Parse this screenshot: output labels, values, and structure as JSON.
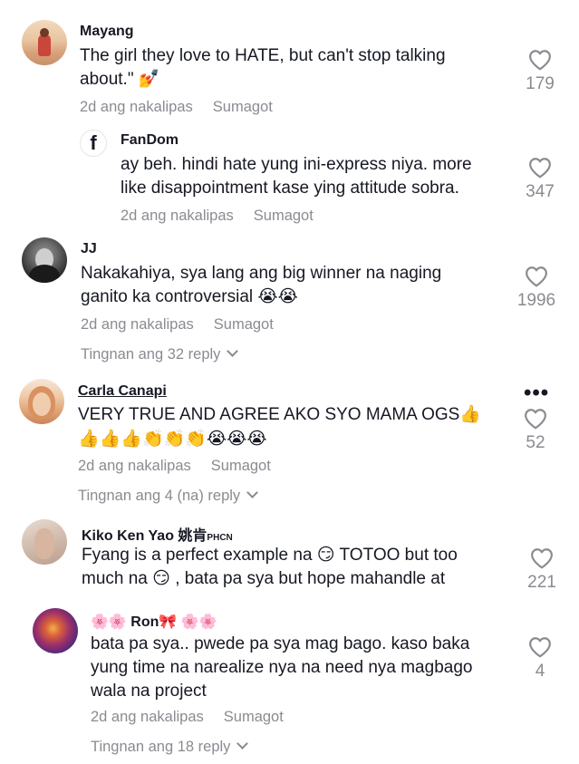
{
  "comments": [
    {
      "author": "Mayang",
      "lines": [
        "The girl they love to HATE, but can't stop talking",
        "about.\" 💅"
      ],
      "time": "2d ang nakalipas",
      "reply_label": "Sumagot",
      "likes": "179",
      "replies": [
        {
          "author": "FanDom",
          "avatar_letter": "f",
          "lines": [
            "ay beh. hindi hate yung ini-express niya. more",
            "like disappointment kase ying attitude sobra."
          ],
          "time": "2d ang nakalipas",
          "reply_label": "Sumagot",
          "likes": "347"
        }
      ]
    },
    {
      "author": "JJ",
      "lines": [
        "Nakakahiya, sya lang ang big winner na naging",
        "ganito ka controversial 😭😭"
      ],
      "time": "2d ang nakalipas",
      "reply_label": "Sumagot",
      "likes": "1996",
      "view_replies": "Tingnan ang 32 reply"
    },
    {
      "author": "Carla Canapi",
      "lines": [
        "VERY TRUE AND AGREE AKO SYO MAMA OGS👍",
        "👍👍👍👏👏👏😭😭😭"
      ],
      "time": "2d ang nakalipas",
      "reply_label": "Sumagot",
      "likes": "52",
      "view_replies": "Tingnan ang 4 (na) reply"
    },
    {
      "author": "Kiko Ken Yao 姚肯",
      "author_suffix": "PHCN",
      "lines": [
        "Fyang is a perfect example na 😏 TOTOO but too",
        "much na 😏 , bata pa sya but hope mahandle at"
      ],
      "likes": "221",
      "replies": [
        {
          "author": "🌸🌸 Ron🎀 🌸🌸",
          "lines": [
            "bata pa sya.. pwede pa sya mag bago. kaso baka",
            "yung time na narealize nya na need nya magbago",
            "wala na project"
          ],
          "time": "2d ang nakalipas",
          "reply_label": "Sumagot",
          "likes": "4"
        }
      ],
      "view_replies": "Tingnan ang 18 reply"
    }
  ],
  "colors": {
    "primary_text": "#161823",
    "secondary_text": "#8a8b91",
    "background": "#ffffff"
  },
  "icons": {
    "like": "heart-outline-icon",
    "more": "more-dots-icon",
    "expand": "chevron-down-icon"
  }
}
